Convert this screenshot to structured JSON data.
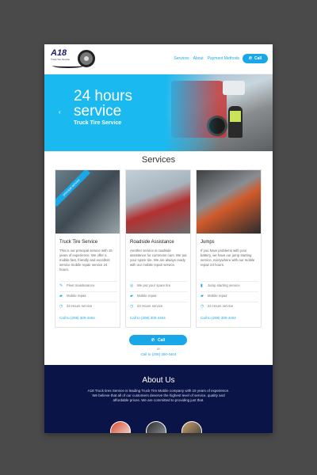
{
  "header": {
    "logo_text": "A18",
    "logo_sub": "Truck Tire Service",
    "nav": [
      "Services",
      "About",
      "Payment Methods"
    ],
    "call_label": "Call"
  },
  "hero": {
    "title_line1": "24 hours",
    "title_line2": "service",
    "subtitle": "Truck Tire Service",
    "prev_arrow": "‹"
  },
  "services": {
    "title": "Services",
    "cards": [
      {
        "ribbon": "principal service",
        "title": "Truck Tire Service",
        "desc": "This is our principal service with 15 years of experience. We offer a mobile fast, friendly and excellent service mobile repair service 24 hours.",
        "features": [
          "Fleet maintenance",
          "Mobile repair",
          "24 Hours service"
        ],
        "call": "Call to (208) 300-4404"
      },
      {
        "title": "Roadside Assistance",
        "desc": "Another service is roadside assistance for commons cars. We put your spare tire. We are always ready with our mobile repair service.",
        "features": [
          "We put your spare tire",
          "Mobile repair",
          "24 Hours service"
        ],
        "call": "Call to (208) 300-4404"
      },
      {
        "title": "Jumps",
        "desc": "If you have problems with your battery, we have our jump starting service, everywhere with our mobile repair 24 hours.",
        "features": [
          "Jump starting service",
          "Mobile repair",
          "24 Hours service"
        ],
        "call": "Call to (208) 300-4404"
      }
    ],
    "call_label": "Call",
    "or_text": "or",
    "phone": "Call to (208) 300-4404"
  },
  "about": {
    "title": "About Us",
    "text": "A18 Truck tires Service is leading Truck Tire Mobile company with 15 years of experience. We believe that all of our customers deserve the highest level of service, quality and affordable prices. We are committed to providing just that."
  },
  "colors": {
    "accent": "#1aa7e8",
    "hero_bg": "#1ab9f0",
    "about_bg": "#0b1446",
    "frame_bg": "#4a4a4a"
  },
  "icons": {
    "fleet": "wrench-icon",
    "spare": "tire-icon",
    "jump": "battery-icon",
    "mobile": "truck-icon",
    "hours": "clock-icon",
    "phone": "phone-icon"
  }
}
